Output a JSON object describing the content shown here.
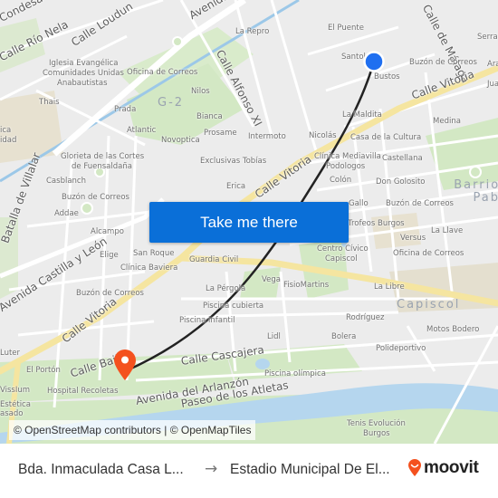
{
  "map": {
    "colors": {
      "background": "#ececec",
      "park": "#d3e8c4",
      "road_major": "#f8e9a8",
      "road_minor": "#ffffff",
      "water": "#b5d6ee",
      "route": "#222222",
      "origin_marker": "#1f6ff0",
      "destination_marker": "#f4511e"
    },
    "streets": [
      "Calle Condesa Mencía",
      "Calle Río Nela",
      "Calle Loudun",
      "Avenida Castilla y León",
      "Calle Alfonso XI",
      "Calle de Málaga",
      "Calle Vitoria",
      "Calle Vitoria",
      "Calle Vitoria",
      "Batalla de Villalar",
      "Avenida Castilla y León",
      "Calle Bailén",
      "Calle Cascajera",
      "Avenida del Arlanzón",
      "Paseo de los Atletas"
    ],
    "districts": [
      "G-2",
      "Barrio San Pablo",
      "Capiscol"
    ],
    "pois": [
      "Iglesia Evangélica",
      "Comunidades Unidas",
      "Anabautistas",
      "Oficina de Correos",
      "La Repro",
      "El Puente",
      "Santol",
      "Bustos",
      "Buzón de Correos",
      "Serrano",
      "Aran",
      "Juan",
      "Thais",
      "Prada",
      "Nilos",
      "Bianca",
      "Atlantic",
      "Prosame",
      "Novoptica",
      "Intermoto",
      "Nicolás",
      "La Maldita",
      "Casa de la Cultura",
      "Medina",
      "Glorieta de las Cortes",
      "de Fuensaldaña",
      "Exclusivas Tobías",
      "Clínica Mediavilla",
      "Podologos",
      "Castellana",
      "Colón",
      "Don Golosito",
      "Casblanch",
      "Buzón de Correos",
      "Erica",
      "Gallo",
      "Buzón de Correos",
      "Addae",
      "Trofeos Burgos",
      "Alcampo",
      "La Llave",
      "Versus",
      "Elige",
      "San Roque",
      "Centro Cívico",
      "Capiscol",
      "Oficina de Correos",
      "Guardia Civil",
      "Clínica Baviera",
      "Vega",
      "FisioMartins",
      "La Libre",
      "Buzón de Correos",
      "La Pérgola",
      "Piscina cubierta",
      "Rodríguez",
      "Piscina infantil",
      "Motos Bodero",
      "Lidl",
      "Bolera",
      "Polideportivo",
      "El Portón",
      "Piscina olímpica",
      "VissIum",
      "Hospital Recoletas",
      "Estética",
      "asado",
      "Tenis Evolución",
      "Burgos",
      "Luter",
      "ica",
      "idad"
    ],
    "attribution": "© OpenStreetMap contributors | © OpenMapTiles"
  },
  "cta": {
    "label": "Take me there"
  },
  "footer": {
    "origin": "Bda. Inmaculada Casa L...",
    "arrow_icon": "arrow-right-icon",
    "destination": "Estadio Municipal De El...",
    "brand": "moovit",
    "brand_color": "#f4511e"
  }
}
